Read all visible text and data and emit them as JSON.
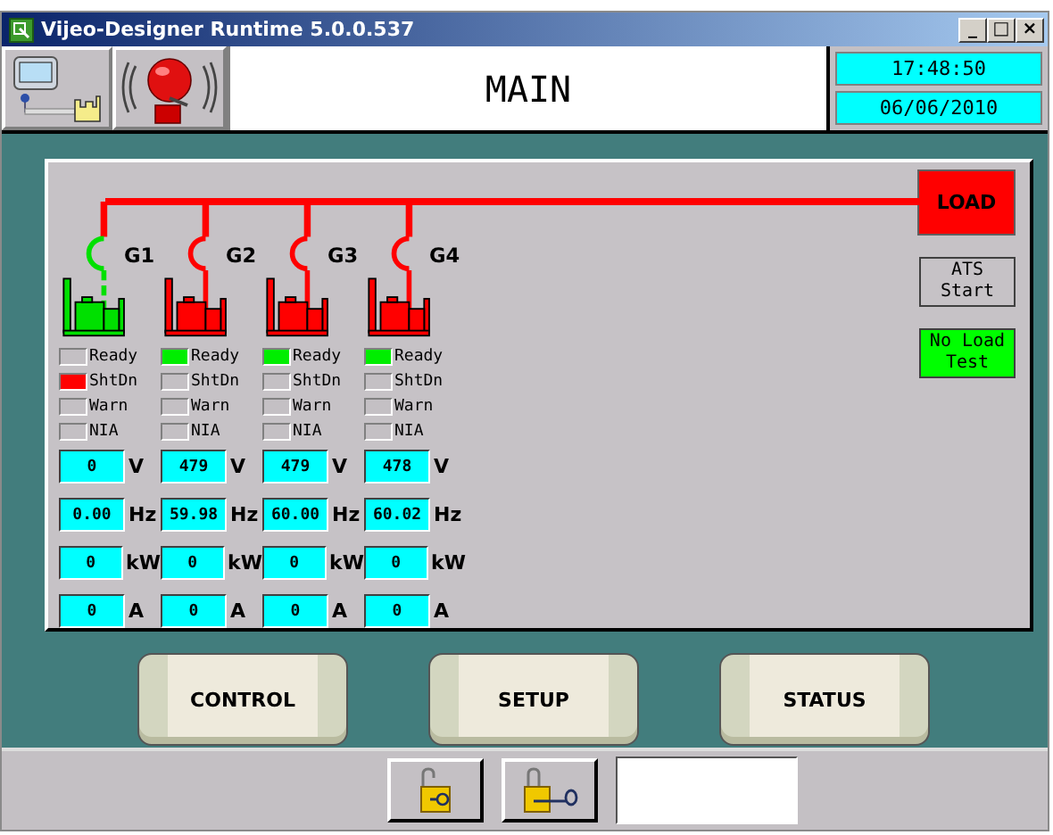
{
  "window": {
    "title": "Vijeo-Designer Runtime 5.0.0.537",
    "controls": [
      "_",
      "□",
      "×"
    ]
  },
  "header": {
    "title": "MAIN",
    "time": "17:48:50",
    "date": "06/06/2010"
  },
  "load_button": {
    "label": "LOAD"
  },
  "side_buttons": [
    {
      "label": "ATS Start",
      "on": false
    },
    {
      "label": "No Load Test",
      "on": true
    }
  ],
  "generators": [
    {
      "label": "G1",
      "running": true,
      "indicators": [
        {
          "label": "Ready",
          "on": false
        },
        {
          "label": "ShtDn",
          "on": true,
          "color": "#ff0000"
        },
        {
          "label": "Warn",
          "on": false
        },
        {
          "label": "NIA",
          "on": false
        }
      ],
      "readings": [
        {
          "value": "0",
          "unit": "V"
        },
        {
          "value": "0.00",
          "unit": "Hz"
        },
        {
          "value": "0",
          "unit": "kW"
        },
        {
          "value": "0",
          "unit": "A"
        }
      ]
    },
    {
      "label": "G2",
      "running": false,
      "indicators": [
        {
          "label": "Ready",
          "on": true,
          "color": "#00ee00"
        },
        {
          "label": "ShtDn",
          "on": false
        },
        {
          "label": "Warn",
          "on": false
        },
        {
          "label": "NIA",
          "on": false
        }
      ],
      "readings": [
        {
          "value": "479",
          "unit": "V"
        },
        {
          "value": "59.98",
          "unit": "Hz"
        },
        {
          "value": "0",
          "unit": "kW"
        },
        {
          "value": "0",
          "unit": "A"
        }
      ]
    },
    {
      "label": "G3",
      "running": false,
      "indicators": [
        {
          "label": "Ready",
          "on": true,
          "color": "#00ee00"
        },
        {
          "label": "ShtDn",
          "on": false
        },
        {
          "label": "Warn",
          "on": false
        },
        {
          "label": "NIA",
          "on": false
        }
      ],
      "readings": [
        {
          "value": "479",
          "unit": "V"
        },
        {
          "value": "60.00",
          "unit": "Hz"
        },
        {
          "value": "0",
          "unit": "kW"
        },
        {
          "value": "0",
          "unit": "A"
        }
      ]
    },
    {
      "label": "G4",
      "running": false,
      "indicators": [
        {
          "label": "Ready",
          "on": true,
          "color": "#00ee00"
        },
        {
          "label": "ShtDn",
          "on": false
        },
        {
          "label": "Warn",
          "on": false
        },
        {
          "label": "NIA",
          "on": false
        }
      ],
      "readings": [
        {
          "value": "478",
          "unit": "V"
        },
        {
          "value": "60.02",
          "unit": "Hz"
        },
        {
          "value": "0",
          "unit": "kW"
        },
        {
          "value": "0",
          "unit": "A"
        }
      ]
    }
  ],
  "nav_buttons": [
    {
      "label": "CONTROL"
    },
    {
      "label": "SETUP"
    },
    {
      "label": "STATUS"
    }
  ]
}
